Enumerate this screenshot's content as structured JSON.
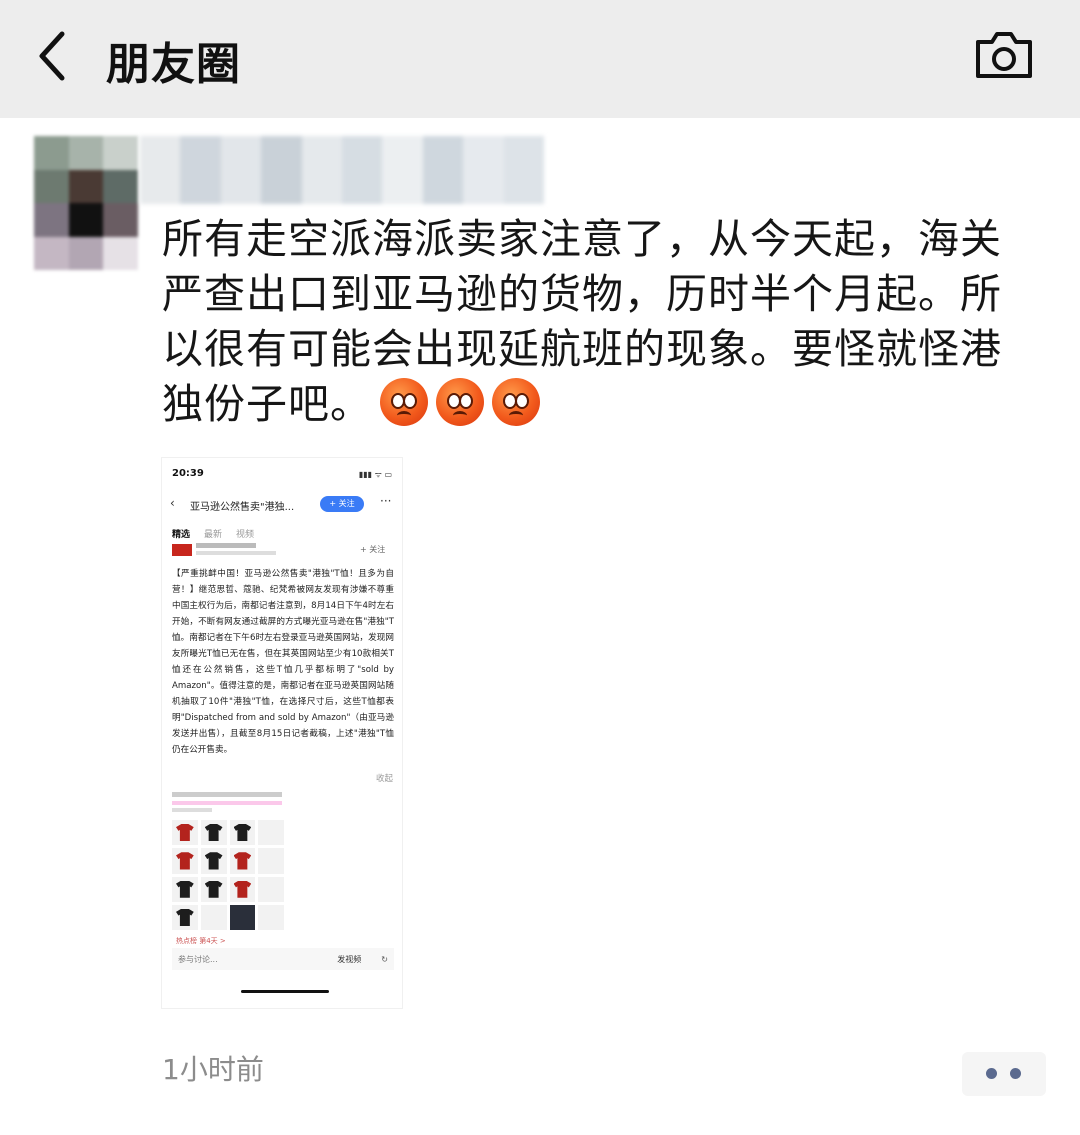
{
  "header": {
    "title": "朋友圈"
  },
  "post": {
    "text": "所有走空派海派卖家注意了，从今天起，海关严查出口到亚马逊的货物，历时半个月起。所以很有可能会出现延航班的现象。要怪就怪港独份子吧。",
    "emoji": "angry-face",
    "time": "1小时前"
  },
  "screenshot": {
    "status_time": "20:39",
    "status_icons": "▮▮▮ ᯤ ▭",
    "nav_title": "亚马逊公然售卖\"港独...",
    "follow": "+ 关注",
    "more": "···",
    "tabs": [
      "精选",
      "最新",
      "视频"
    ],
    "follow_small": "+ 关注",
    "article": "【严重挑衅中国！亚马逊公然售卖\"港独\"T恤！且多为自营！】继范思哲、蔻驰、纪梵希被网友发现有涉嫌不尊重中国主权行为后，南都记者注意到，8月14日下午4时左右开始，不断有网友通过截屏的方式曝光亚马逊在售\"港独\"T恤。南都记者在下午6时左右登录亚马逊英国网站，发现网友所曝光T恤已无在售，但在其英国网站至少有10款相关T恤还在公然销售，这些T恤几乎都标明了\"sold by Amazon\"。值得注意的是，南都记者在亚马逊英国网站随机抽取了10件\"港独\"T恤，在选择尺寸后，这些T恤都表明\"Dispatched from and sold by Amazon\"（由亚马逊发送并出售），且截至8月15日记者截稿，上述\"港独\"T恤仍在公开售卖。",
    "collapse": "收起",
    "hot_label": "热点榜 第4天 >",
    "comment_placeholder": "参与讨论...",
    "video_label": "发视频"
  },
  "colors": {
    "topbar": "#ededed",
    "time_gray": "#8c8c8c",
    "dots": "#5b6a8f"
  }
}
